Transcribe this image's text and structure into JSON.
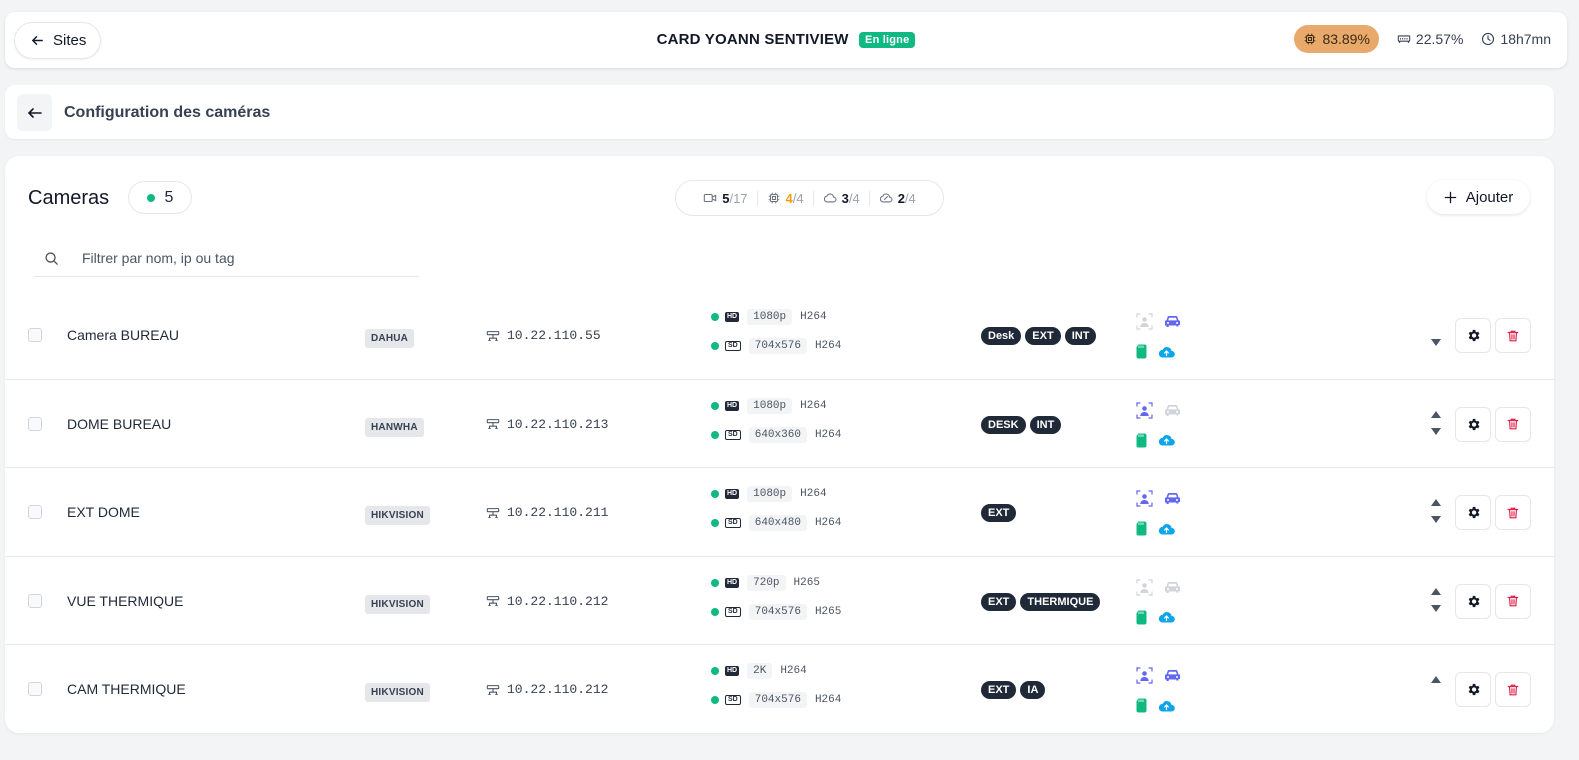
{
  "topbar": {
    "back_label": "Sites",
    "site_name": "CARD YOANN SENTIVIEW",
    "status": "En ligne",
    "cpu": "83.89%",
    "memory": "22.57%",
    "uptime": "18h7mn"
  },
  "config": {
    "title": "Configuration des caméras"
  },
  "cameras_header": {
    "title": "Cameras",
    "online_count": "5",
    "stats": {
      "cameras_used": "5",
      "cameras_total": "/17",
      "ai_used": "4",
      "ai_total": "/4",
      "cloud_used": "3",
      "cloud_total": "/4",
      "cloud2_used": "2",
      "cloud2_total": "/4"
    },
    "add_label": "Ajouter",
    "search_placeholder": "Filtrer par nom, ip ou tag"
  },
  "colors": {
    "online": "#10b981",
    "cpu_badge": "#e8a96a",
    "ai_person": "#6366f1",
    "sd_card": "#10b981",
    "cloud": "#0ea5e9",
    "delete": "#e11d48"
  },
  "cameras": [
    {
      "name": "Camera BUREAU",
      "brand": "DAHUA",
      "ip": "10.22.110.55",
      "hd_label": "HD",
      "hd_res": "1080p",
      "hd_codec": "H264",
      "sd_label": "SD",
      "sd_res": "704x576",
      "sd_codec": "H264",
      "tags": [
        "Desk",
        "EXT",
        "INT"
      ],
      "person_active": false,
      "vehicle_active": true,
      "up_visible": false,
      "down_visible": true
    },
    {
      "name": "DOME BUREAU",
      "brand": "HANWHA",
      "ip": "10.22.110.213",
      "hd_label": "HD",
      "hd_res": "1080p",
      "hd_codec": "H264",
      "sd_label": "SD",
      "sd_res": "640x360",
      "sd_codec": "H264",
      "tags": [
        "DESK",
        "INT"
      ],
      "person_active": true,
      "vehicle_active": false,
      "up_visible": true,
      "down_visible": true
    },
    {
      "name": "EXT DOME",
      "brand": "HIKVISION",
      "ip": "10.22.110.211",
      "hd_label": "HD",
      "hd_res": "1080p",
      "hd_codec": "H264",
      "sd_label": "SD",
      "sd_res": "640x480",
      "sd_codec": "H264",
      "tags": [
        "EXT"
      ],
      "person_active": true,
      "vehicle_active": true,
      "up_visible": true,
      "down_visible": true
    },
    {
      "name": "VUE THERMIQUE",
      "brand": "HIKVISION",
      "ip": "10.22.110.212",
      "hd_label": "HD",
      "hd_res": "720p",
      "hd_codec": "H265",
      "sd_label": "SD",
      "sd_res": "704x576",
      "sd_codec": "H265",
      "tags": [
        "EXT",
        "THERMIQUE"
      ],
      "person_active": false,
      "vehicle_active": false,
      "up_visible": true,
      "down_visible": true
    },
    {
      "name": "CAM THERMIQUE",
      "brand": "HIKVISION",
      "ip": "10.22.110.212",
      "hd_label": "HD",
      "hd_res": "2K",
      "hd_codec": "H264",
      "sd_label": "SD",
      "sd_res": "704x576",
      "sd_codec": "H264",
      "tags": [
        "EXT",
        "IA"
      ],
      "person_active": true,
      "vehicle_active": true,
      "up_visible": true,
      "down_visible": false
    }
  ]
}
